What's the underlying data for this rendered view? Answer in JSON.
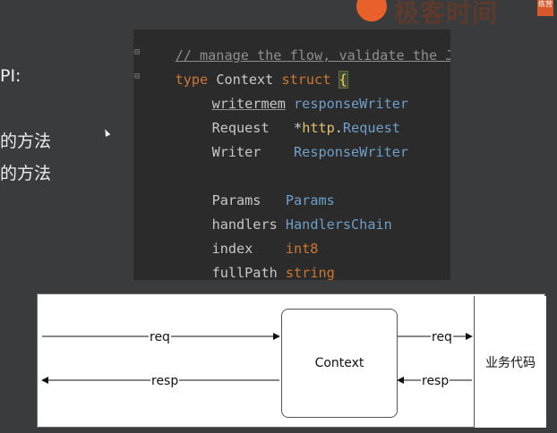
{
  "brand": {
    "text": "极客时间",
    "badge": "练营"
  },
  "slide": {
    "api_text": "PI:",
    "line1": "的方法",
    "line2": "的方法"
  },
  "code": {
    "line1": {
      "comment": "// manage the flow, validate the JS"
    },
    "line2": {
      "kw_type": "type",
      "name": "Context",
      "kw_struct": "struct",
      "brace": "{"
    },
    "fields": [
      {
        "name": "writermem",
        "type": "responseWriter"
      },
      {
        "name": "Request",
        "type_prefix": "*",
        "type_pkg": "http",
        "type_dot": ".",
        "type_name": "Request"
      },
      {
        "name": "Writer",
        "type": "ResponseWriter"
      },
      {
        "name": "Params",
        "type": "Params"
      },
      {
        "name": "handlers",
        "type": "HandlersChain"
      },
      {
        "name": "index",
        "type": "int8"
      },
      {
        "name": "fullPath",
        "type": "string"
      }
    ]
  },
  "diagram": {
    "context_label": "Context",
    "business_label": "业务代码",
    "req_label_left": "req",
    "resp_label_left": "resp",
    "req_label_right": "req",
    "resp_label_right": "resp"
  }
}
